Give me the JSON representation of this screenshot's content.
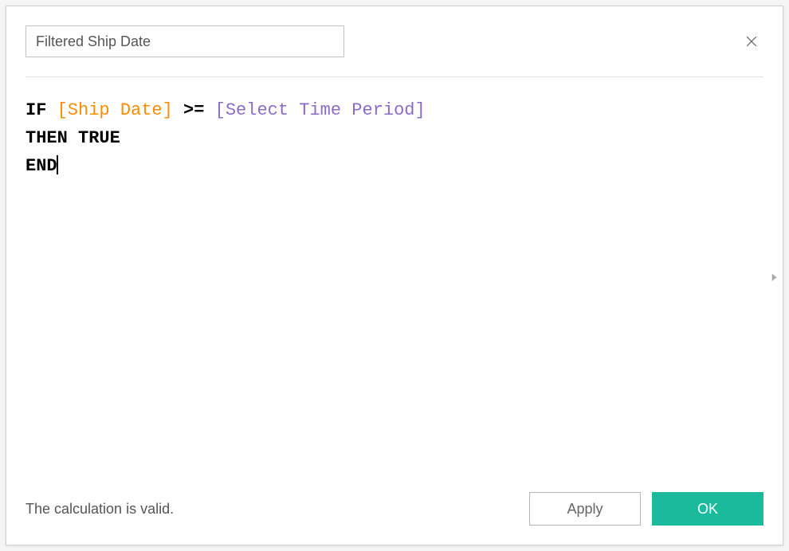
{
  "header": {
    "field_name": "Filtered Ship Date"
  },
  "formula": {
    "line1": {
      "kw_if": "IF",
      "field1": "[Ship Date]",
      "op": ">=",
      "param1": "[Select Time Period]"
    },
    "line2": {
      "indent": "    ",
      "kw_then": "THEN",
      "bool": "TRUE"
    },
    "line3": {
      "kw_end": "END"
    }
  },
  "footer": {
    "status": "The calculation is valid.",
    "apply_label": "Apply",
    "ok_label": "OK"
  },
  "icons": {
    "close": "close-icon",
    "expand": "chevron-right-icon"
  }
}
